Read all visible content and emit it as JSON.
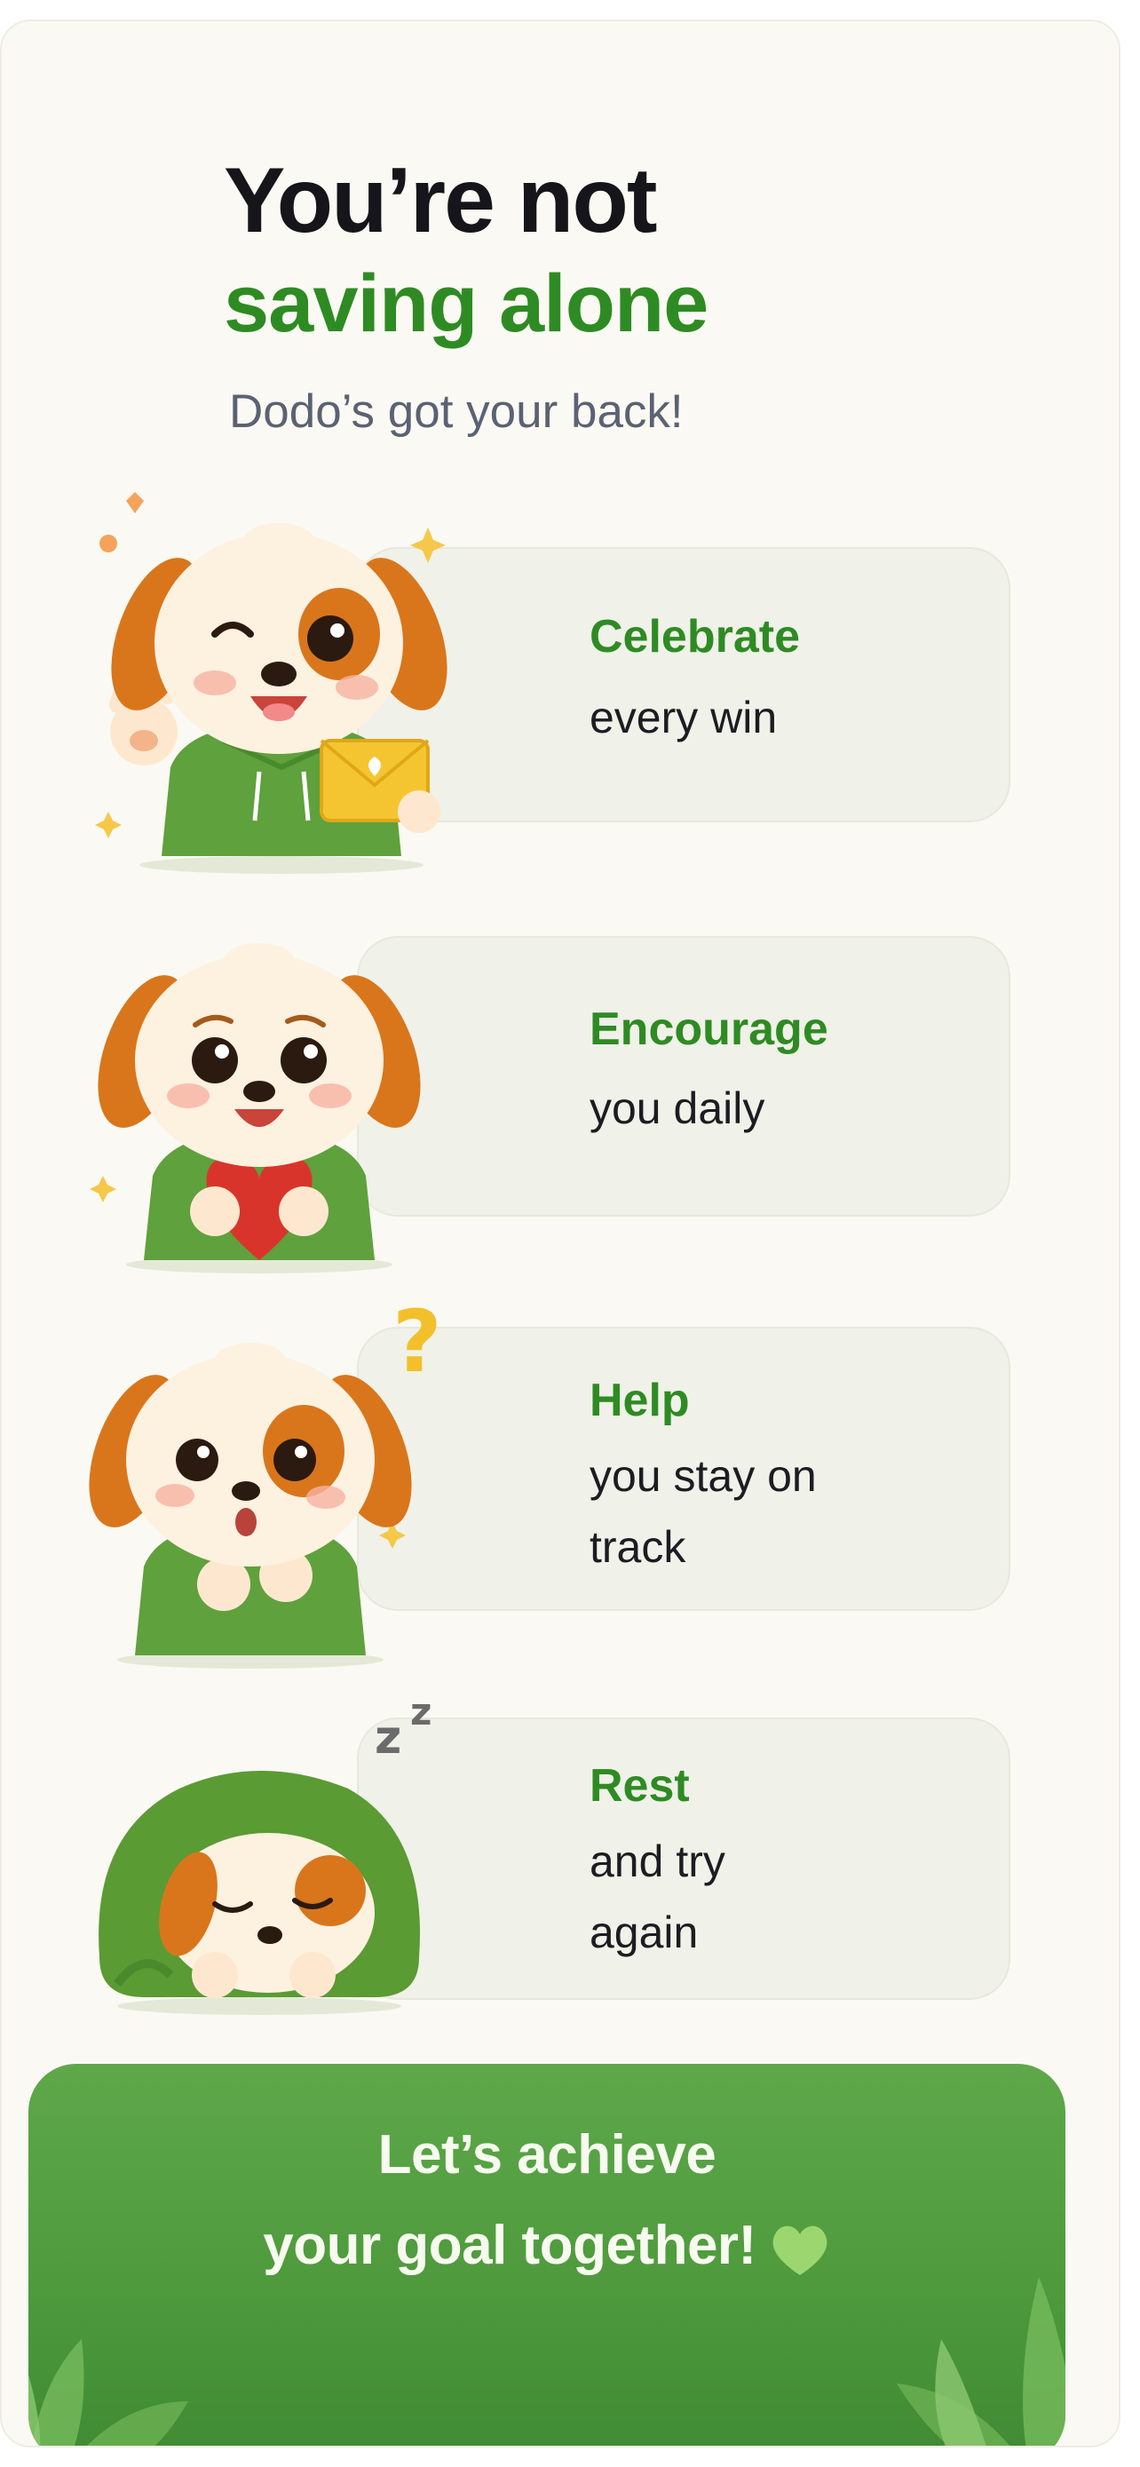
{
  "header": {
    "title_line1": "You’re not",
    "title_line2": "saving alone",
    "subtitle": "Dodo’s got your back!"
  },
  "cards": [
    {
      "title": "Celebrate",
      "text_line1": "every win",
      "text_line2": "",
      "mascot_icon": "dodo-waving-with-envelope-icon"
    },
    {
      "title": "Encourage",
      "text_line1": "you daily",
      "text_line2": "",
      "mascot_icon": "dodo-holding-heart-icon"
    },
    {
      "title": "Help",
      "text_line1": "you stay on",
      "text_line2": "track",
      "mascot_icon": "dodo-thinking-question-icon"
    },
    {
      "title": "Rest",
      "text_line1": "and try",
      "text_line2": "again",
      "mascot_icon": "dodo-sleeping-in-blanket-icon"
    }
  ],
  "banner": {
    "line1": "Let’s achieve",
    "line2": "your goal together!",
    "icon": "green-heart-icon"
  },
  "colors": {
    "accent_green": "#2e8b23",
    "banner_green": "#4e9a3d",
    "card_bg": "#f0f1e8",
    "page_bg": "#fbf9f3",
    "title_dark": "#15151a",
    "subtitle_gray": "#5a6273"
  }
}
